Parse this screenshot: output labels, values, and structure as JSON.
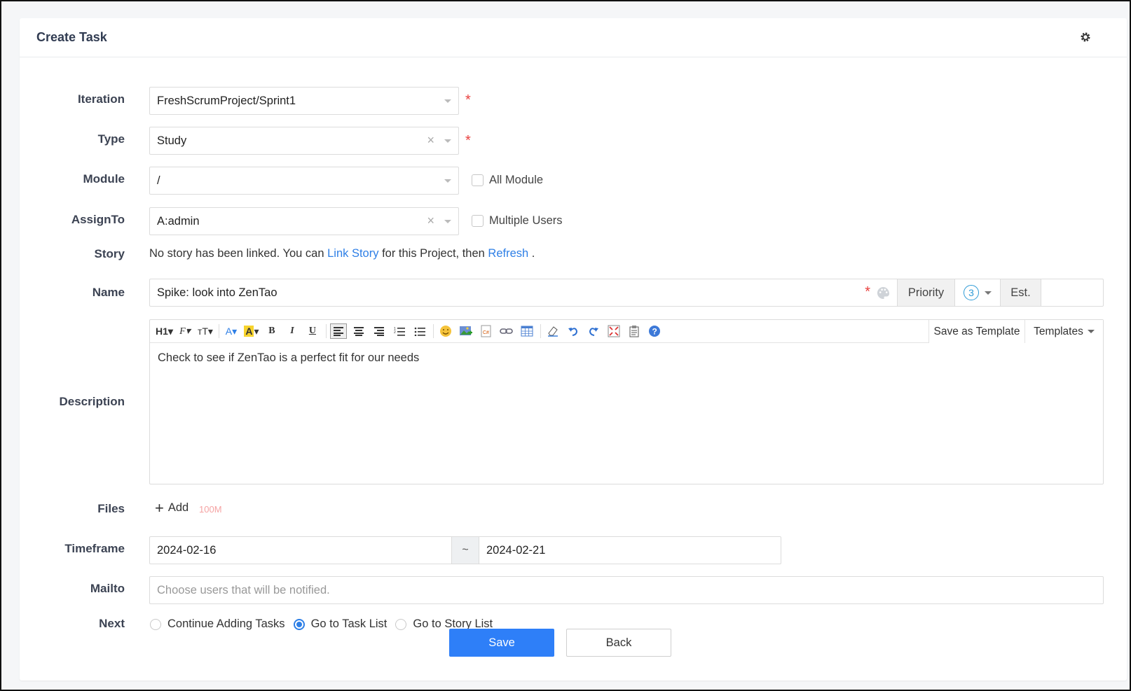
{
  "header": {
    "title": "Create Task"
  },
  "form": {
    "iteration": {
      "label": "Iteration",
      "value": "FreshScrumProject/Sprint1"
    },
    "type": {
      "label": "Type",
      "value": "Study"
    },
    "module": {
      "label": "Module",
      "value": "/",
      "checkbox_label": "All Module"
    },
    "assign_to": {
      "label": "AssignTo",
      "value": "A:admin",
      "checkbox_label": "Multiple Users"
    },
    "story": {
      "label": "Story",
      "text_before": "No story has been linked. You can",
      "link_story": "Link Story",
      "text_middle": "for this Project, then",
      "refresh": "Refresh",
      "text_after": "."
    },
    "name": {
      "label": "Name",
      "value": "Spike: look into ZenTao",
      "priority_label": "Priority",
      "priority_value": "3",
      "est_label": "Est."
    },
    "description": {
      "label": "Description",
      "content": "Check to see if ZenTao is a perfect fit for our needs",
      "save_template": "Save as Template",
      "templates": "Templates"
    },
    "files": {
      "label": "Files",
      "add": "Add",
      "limit": "100M"
    },
    "timeframe": {
      "label": "Timeframe",
      "start": "2024-02-16",
      "separator": "~",
      "end": "2024-02-21"
    },
    "mailto": {
      "label": "Mailto",
      "placeholder": "Choose users that will be notified."
    },
    "next": {
      "label": "Next",
      "options": [
        "Continue Adding Tasks",
        "Go to Task List",
        "Go to Story List"
      ],
      "selected": "Go to Task List"
    }
  },
  "actions": {
    "save": "Save",
    "back": "Back"
  },
  "toolbar_icons": [
    "heading-icon",
    "font-family-icon",
    "font-size-icon",
    "font-color-icon",
    "highlight-icon",
    "bold-icon",
    "italic-icon",
    "underline-icon",
    "align-left-icon",
    "align-center-icon",
    "align-right-icon",
    "ordered-list-icon",
    "unordered-list-icon",
    "emoji-icon",
    "image-icon",
    "code-icon",
    "link-icon",
    "table-icon",
    "eraser-icon",
    "undo-icon",
    "redo-icon",
    "fullscreen-icon",
    "paste-icon",
    "help-icon"
  ],
  "colors": {
    "primary": "#2e7ff8",
    "required": "#e9413f",
    "link": "#2e7fe6"
  }
}
